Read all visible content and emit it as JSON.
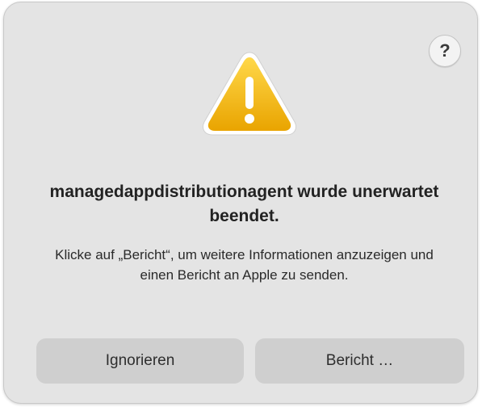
{
  "dialog": {
    "help_label": "?",
    "icon": "warning-icon",
    "title": "managedappdistributionagent wurde unerwartet beendet.",
    "message": "Klicke auf „Bericht“, um weitere Informationen anzuzeigen und einen Bericht an Apple zu senden.",
    "buttons": {
      "ignore": "Ignorieren",
      "report": "Bericht …"
    }
  },
  "colors": {
    "dialog_background": "#e4e4e4",
    "button_background": "#cfcfcf",
    "warning_yellow": "#f2b818",
    "warning_border": "#ffffff"
  }
}
